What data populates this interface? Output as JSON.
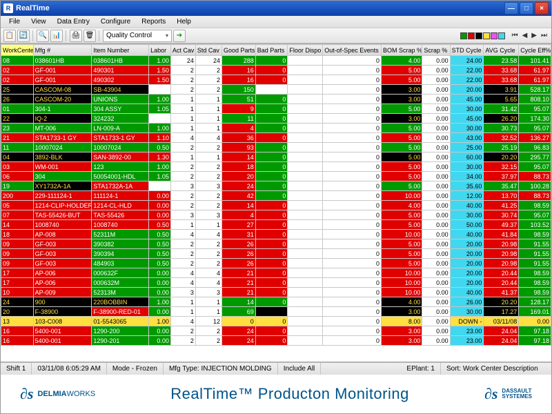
{
  "window": {
    "title": "RealTime"
  },
  "menu": {
    "items": [
      "File",
      "View",
      "Data Entry",
      "Configure",
      "Reports",
      "Help"
    ]
  },
  "toolbar": {
    "combo": "Quality Control"
  },
  "status": {
    "shift": "Shift 1",
    "ts": "03/11/08 6:05:29 AM",
    "mode": "Mode - Frozen",
    "mfg": "Mfg Type: INJECTION MOLDING",
    "include": "Include All",
    "eplant": "EPlant: 1",
    "sort": "Sort: Work Center Description"
  },
  "footer": {
    "brand1": "DELMIA",
    "brand1b": "WORKS",
    "title": "RealTime™ Producton Monitoring",
    "brand2": "DASSAULT",
    "brand2b": "SYSTEMES"
  },
  "columns": [
    "WorkCente",
    "Mfg #",
    "Item Number",
    "Labor",
    "Act Cav",
    "Std Cav",
    "Good Parts",
    "Bad Parts",
    "Floor Dispo",
    "Out-of-Spec Events",
    "BOM Scrap %",
    "Scrap %",
    "STD Cycle",
    "AVG Cycle",
    "Cycle Eff%"
  ],
  "bg_default": [
    "green",
    "green",
    "green",
    "green",
    "white",
    "white",
    "green",
    "green",
    "white",
    "white",
    "green",
    "white",
    "aqua",
    "green",
    "green"
  ],
  "rows": [
    {
      "bg": [
        "green",
        "green",
        "green",
        "green",
        "white",
        "white",
        "green",
        "green",
        "white",
        "white",
        "green",
        "white",
        "aqua",
        "green",
        "green"
      ],
      "cells": [
        "08",
        "038601HB",
        "038601HB",
        "1.00",
        "24",
        "24",
        "288",
        "0",
        "",
        "0",
        "4.00",
        "0.00",
        "24.00",
        "23.58",
        "101.41"
      ]
    },
    {
      "bg": [
        "red",
        "red",
        "red",
        "red",
        "white",
        "white",
        "red",
        "red",
        "white",
        "white",
        "red",
        "white",
        "aqua",
        "red",
        "red"
      ],
      "cells": [
        "02",
        "GF-001",
        "490301",
        "1.50",
        "2",
        "2",
        "16",
        "0",
        "",
        "0",
        "5.00",
        "0.00",
        "22.00",
        "33.68",
        "61.97"
      ]
    },
    {
      "bg": [
        "red",
        "red",
        "red",
        "red",
        "white",
        "white",
        "red",
        "red",
        "white",
        "white",
        "red",
        "white",
        "aqua",
        "red",
        "red"
      ],
      "cells": [
        "02",
        "GF-001",
        "490302",
        "1.50",
        "2",
        "2",
        "16",
        "0",
        "",
        "0",
        "5.00",
        "0.00",
        "22.00",
        "33.68",
        "61.97"
      ]
    },
    {
      "bg": [
        "black",
        "black",
        "black",
        "white",
        "white",
        "white",
        "green",
        "white",
        "white",
        "white",
        "black",
        "white",
        "aqua",
        "black",
        "green"
      ],
      "cells": [
        "25",
        "CASCOM-08",
        "SB-43904",
        "",
        "2",
        "2",
        "150",
        "",
        "",
        "0",
        "3.00",
        "0.00",
        "20.00",
        "3.91",
        "528.17"
      ]
    },
    {
      "bg": [
        "black",
        "black",
        "green",
        "green",
        "white",
        "white",
        "green",
        "green",
        "white",
        "white",
        "black",
        "white",
        "aqua",
        "black",
        "green"
      ],
      "cells": [
        "26",
        "CASCOM-20",
        "UNIONS",
        "1.00",
        "1",
        "1",
        "51",
        "0",
        "",
        "0",
        "3.00",
        "0.00",
        "45.00",
        "5.65",
        "808.10"
      ]
    },
    {
      "bg": [
        "green",
        "green",
        "green",
        "green",
        "white",
        "white",
        "red",
        "green",
        "white",
        "white",
        "green",
        "white",
        "aqua",
        "green",
        "green"
      ],
      "cells": [
        "01",
        "304-1",
        "304 ASSY",
        "1.05",
        "1",
        "1",
        "9",
        "0",
        "",
        "0",
        "5.00",
        "0.00",
        "30.00",
        "31.42",
        "95.07"
      ]
    },
    {
      "bg": [
        "black",
        "black",
        "green",
        "white",
        "white",
        "white",
        "green",
        "green",
        "white",
        "white",
        "black",
        "white",
        "aqua",
        "black",
        "green"
      ],
      "cells": [
        "22",
        "IQ-2",
        "324232",
        "",
        "1",
        "1",
        "11",
        "0",
        "",
        "0",
        "3.00",
        "0.00",
        "45.00",
        "26.20",
        "174.30"
      ]
    },
    {
      "bg": [
        "green",
        "green",
        "green",
        "green",
        "white",
        "white",
        "red",
        "green",
        "white",
        "white",
        "green",
        "white",
        "aqua",
        "green",
        "green"
      ],
      "cells": [
        "23",
        "MT-006",
        "LN-009-A",
        "1.00",
        "1",
        "1",
        "4",
        "0",
        "",
        "0",
        "5.00",
        "0.00",
        "30.00",
        "30.73",
        "95.07"
      ]
    },
    {
      "bg": [
        "red",
        "red",
        "red",
        "red",
        "white",
        "white",
        "red",
        "red",
        "white",
        "white",
        "red",
        "white",
        "aqua",
        "red",
        "red"
      ],
      "cells": [
        "21",
        "STA1733-1 GY",
        "STA1733-1 GY",
        "1.10",
        "4",
        "4",
        "36",
        "0",
        "",
        "0",
        "5.00",
        "0.00",
        "43.00",
        "32.52",
        "136.27"
      ]
    },
    {
      "bg": [
        "green",
        "green",
        "green",
        "green",
        "white",
        "white",
        "red",
        "green",
        "white",
        "white",
        "green",
        "white",
        "aqua",
        "green",
        "green"
      ],
      "cells": [
        "11",
        "10007024",
        "10007024",
        "0.50",
        "2",
        "2",
        "93",
        "0",
        "",
        "0",
        "5.00",
        "0.00",
        "25.00",
        "25.19",
        "96.83"
      ]
    },
    {
      "bg": [
        "black",
        "black",
        "red",
        "red",
        "white",
        "white",
        "red",
        "green",
        "white",
        "white",
        "black",
        "white",
        "aqua",
        "black",
        "green"
      ],
      "cells": [
        "04",
        "3892-BLK",
        "SAN-3892-00",
        "1.30",
        "1",
        "1",
        "14",
        "0",
        "",
        "0",
        "5.00",
        "0.00",
        "60.00",
        "20.20",
        "295.77"
      ]
    },
    {
      "bg": [
        "red",
        "red",
        "green",
        "green",
        "white",
        "white",
        "red",
        "green",
        "white",
        "white",
        "red",
        "white",
        "aqua",
        "red",
        "green"
      ],
      "cells": [
        "03",
        "WM-001",
        "123",
        "1.00",
        "2",
        "2",
        "18",
        "0",
        "",
        "0",
        "5.00",
        "0.00",
        "30.00",
        "32.15",
        "95.07"
      ]
    },
    {
      "bg": [
        "red",
        "green",
        "green",
        "green",
        "white",
        "white",
        "red",
        "green",
        "white",
        "white",
        "red",
        "white",
        "aqua",
        "red",
        "red"
      ],
      "cells": [
        "06",
        "304",
        "50054001-HDL",
        "1.05",
        "2",
        "2",
        "20",
        "0",
        "",
        "0",
        "5.00",
        "0.00",
        "34.00",
        "37.97",
        "88.73"
      ]
    },
    {
      "bg": [
        "green",
        "black",
        "red",
        "white",
        "white",
        "white",
        "red",
        "green",
        "white",
        "white",
        "green",
        "white",
        "aqua",
        "green",
        "green"
      ],
      "cells": [
        "19",
        "XY1732A-1A",
        "STA1732A-1A",
        "",
        "3",
        "3",
        "24",
        "0",
        "",
        "0",
        "5.00",
        "0.00",
        "35.60",
        "35.47",
        "100.28"
      ]
    },
    {
      "bg": [
        "red",
        "red",
        "red",
        "red",
        "white",
        "white",
        "red",
        "green",
        "white",
        "white",
        "red",
        "white",
        "aqua",
        "red",
        "red"
      ],
      "cells": [
        "200",
        "229-111124-1",
        "111124-1",
        "0.00",
        "2",
        "2",
        "42",
        "0",
        "",
        "0",
        "10.00",
        "0.00",
        "12.00",
        "13.70",
        "88.73"
      ]
    },
    {
      "bg": [
        "red",
        "red",
        "red",
        "red",
        "white",
        "white",
        "red",
        "red",
        "white",
        "white",
        "red",
        "white",
        "aqua",
        "red",
        "green"
      ],
      "cells": [
        "05",
        "1214-CLIP-HOLDER",
        "1214-CL-HLD",
        "0.00",
        "2",
        "2",
        "14",
        "0",
        "",
        "0",
        "4.00",
        "0.00",
        "40.00",
        "41.25",
        "98.59"
      ]
    },
    {
      "bg": [
        "red",
        "red",
        "red",
        "red",
        "white",
        "white",
        "red",
        "red",
        "white",
        "white",
        "red",
        "white",
        "aqua",
        "red",
        "green"
      ],
      "cells": [
        "07",
        "TAS-55426-BUT",
        "TAS-55426",
        "0.00",
        "3",
        "3",
        "4",
        "0",
        "",
        "0",
        "5.00",
        "0.00",
        "30.00",
        "30.74",
        "95.07"
      ]
    },
    {
      "bg": [
        "red",
        "red",
        "red",
        "red",
        "white",
        "white",
        "red",
        "red",
        "white",
        "white",
        "red",
        "white",
        "aqua",
        "red",
        "green"
      ],
      "cells": [
        "14",
        "1008740",
        "1008740",
        "0.50",
        "1",
        "1",
        "27",
        "0",
        "",
        "0",
        "5.00",
        "0.00",
        "50.00",
        "49.37",
        "103.52"
      ]
    },
    {
      "bg": [
        "red",
        "red",
        "green",
        "green",
        "white",
        "white",
        "red",
        "red",
        "white",
        "white",
        "red",
        "white",
        "aqua",
        "red",
        "green"
      ],
      "cells": [
        "18",
        "AP-008",
        "52311M",
        "0.50",
        "4",
        "4",
        "31",
        "0",
        "",
        "0",
        "10.00",
        "0.00",
        "40.00",
        "41.84",
        "98.59"
      ]
    },
    {
      "bg": [
        "red",
        "red",
        "green",
        "green",
        "white",
        "white",
        "red",
        "red",
        "white",
        "white",
        "red",
        "white",
        "aqua",
        "red",
        "green"
      ],
      "cells": [
        "09",
        "GF-003",
        "390382",
        "0.50",
        "2",
        "2",
        "26",
        "0",
        "",
        "0",
        "5.00",
        "0.00",
        "20.00",
        "20.98",
        "91.55"
      ]
    },
    {
      "bg": [
        "red",
        "red",
        "green",
        "green",
        "white",
        "white",
        "red",
        "red",
        "white",
        "white",
        "red",
        "white",
        "aqua",
        "red",
        "green"
      ],
      "cells": [
        "09",
        "GF-003",
        "390394",
        "0.50",
        "2",
        "2",
        "26",
        "0",
        "",
        "0",
        "5.00",
        "0.00",
        "20.00",
        "20.98",
        "91.55"
      ]
    },
    {
      "bg": [
        "red",
        "red",
        "green",
        "green",
        "white",
        "white",
        "red",
        "red",
        "white",
        "white",
        "red",
        "white",
        "aqua",
        "red",
        "green"
      ],
      "cells": [
        "09",
        "GF-003",
        "484903",
        "0.50",
        "2",
        "2",
        "26",
        "0",
        "",
        "0",
        "5.00",
        "0.00",
        "20.00",
        "20.98",
        "91.55"
      ]
    },
    {
      "bg": [
        "red",
        "red",
        "green",
        "green",
        "white",
        "white",
        "red",
        "red",
        "white",
        "white",
        "red",
        "white",
        "aqua",
        "red",
        "green"
      ],
      "cells": [
        "17",
        "AP-006",
        "000632F",
        "0.00",
        "4",
        "4",
        "21",
        "0",
        "",
        "0",
        "10.00",
        "0.00",
        "20.00",
        "20.44",
        "98.59"
      ]
    },
    {
      "bg": [
        "red",
        "red",
        "green",
        "green",
        "white",
        "white",
        "red",
        "red",
        "white",
        "white",
        "red",
        "white",
        "aqua",
        "red",
        "green"
      ],
      "cells": [
        "17",
        "AP-006",
        "000632M",
        "0.00",
        "4",
        "4",
        "21",
        "0",
        "",
        "0",
        "10.00",
        "0.00",
        "20.00",
        "20.44",
        "98.59"
      ]
    },
    {
      "bg": [
        "red",
        "red",
        "green",
        "green",
        "white",
        "white",
        "red",
        "red",
        "white",
        "white",
        "red",
        "white",
        "aqua",
        "red",
        "green"
      ],
      "cells": [
        "10",
        "AP-009",
        "52313M",
        "0.00",
        "3",
        "3",
        "21",
        "0",
        "",
        "0",
        "10.00",
        "0.00",
        "40.00",
        "41.37",
        "98.59"
      ]
    },
    {
      "bg": [
        "black",
        "black",
        "black",
        "green",
        "white",
        "white",
        "green",
        "green",
        "white",
        "white",
        "black",
        "white",
        "aqua",
        "black",
        "green"
      ],
      "cells": [
        "24",
        "900",
        "220BOBBIN",
        "1.00",
        "1",
        "1",
        "14",
        "0",
        "",
        "0",
        "4.00",
        "0.00",
        "26.00",
        "20.20",
        "128.17"
      ]
    },
    {
      "bg": [
        "black",
        "black",
        "red",
        "green",
        "white",
        "white",
        "green",
        "black",
        "white",
        "white",
        "black",
        "white",
        "aqua",
        "black",
        "green"
      ],
      "cells": [
        "20",
        "F-38900",
        "F-38900-RED-01",
        "0.00",
        "1",
        "1",
        "69",
        "",
        "",
        "0",
        "3.00",
        "0.00",
        "30.00",
        "17.27",
        "169.01"
      ]
    },
    {
      "bg": [
        "yellow",
        "yellow",
        "yellow",
        "yellow",
        "white",
        "white",
        "yellow",
        "yellow",
        "white",
        "white",
        "yellow",
        "white",
        "yellow",
        "yellow",
        "yellow"
      ],
      "cells": [
        "13",
        "103-C008",
        "01-5543065",
        "1.00",
        "4",
        "12",
        "0",
        "0",
        "",
        "0",
        "8.00",
        "0.00",
        "DOWN -",
        "03/11/08",
        "0.00"
      ]
    },
    {
      "bg": [
        "red",
        "red",
        "green",
        "green",
        "white",
        "white",
        "red",
        "red",
        "white",
        "white",
        "red",
        "white",
        "aqua",
        "red",
        "green"
      ],
      "cells": [
        "16",
        "5400-001",
        "1290-200",
        "0.00",
        "2",
        "2",
        "24",
        "0",
        "",
        "0",
        "3.00",
        "0.00",
        "23.00",
        "24.04",
        "97.18"
      ]
    },
    {
      "bg": [
        "red",
        "red",
        "green",
        "green",
        "white",
        "white",
        "red",
        "red",
        "white",
        "white",
        "red",
        "white",
        "aqua",
        "red",
        "green"
      ],
      "cells": [
        "16",
        "5400-001",
        "1290-201",
        "0.00",
        "2",
        "2",
        "24",
        "0",
        "",
        "0",
        "3.00",
        "0.00",
        "23.00",
        "24.04",
        "97.18"
      ]
    }
  ]
}
